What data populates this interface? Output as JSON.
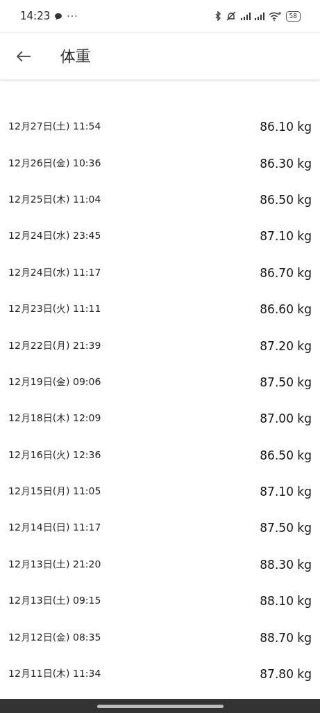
{
  "status_bar": {
    "time": "14:23",
    "more": "···",
    "battery": "58"
  },
  "app_bar": {
    "title": "体重"
  },
  "entries": [
    {
      "date": "12月27日(土) 11:54",
      "weight": "86.10 kg"
    },
    {
      "date": "12月26日(金) 10:36",
      "weight": "86.30 kg"
    },
    {
      "date": "12月25日(木) 11:04",
      "weight": "86.50 kg"
    },
    {
      "date": "12月24日(水) 23:45",
      "weight": "87.10 kg"
    },
    {
      "date": "12月24日(水) 11:17",
      "weight": "86.70 kg"
    },
    {
      "date": "12月23日(火) 11:11",
      "weight": "86.60 kg"
    },
    {
      "date": "12月22日(月) 21:39",
      "weight": "87.20 kg"
    },
    {
      "date": "12月19日(金) 09:06",
      "weight": "87.50 kg"
    },
    {
      "date": "12月18日(木) 12:09",
      "weight": "87.00 kg"
    },
    {
      "date": "12月16日(火) 12:36",
      "weight": "86.50 kg"
    },
    {
      "date": "12月15日(月) 11:05",
      "weight": "87.10 kg"
    },
    {
      "date": "12月14日(日) 11:17",
      "weight": "87.50 kg"
    },
    {
      "date": "12月13日(土) 21:20",
      "weight": "88.30 kg"
    },
    {
      "date": "12月13日(土) 09:15",
      "weight": "88.10 kg"
    },
    {
      "date": "12月12日(金) 08:35",
      "weight": "88.70 kg"
    },
    {
      "date": "12月11日(木) 11:34",
      "weight": "87.80 kg"
    }
  ]
}
